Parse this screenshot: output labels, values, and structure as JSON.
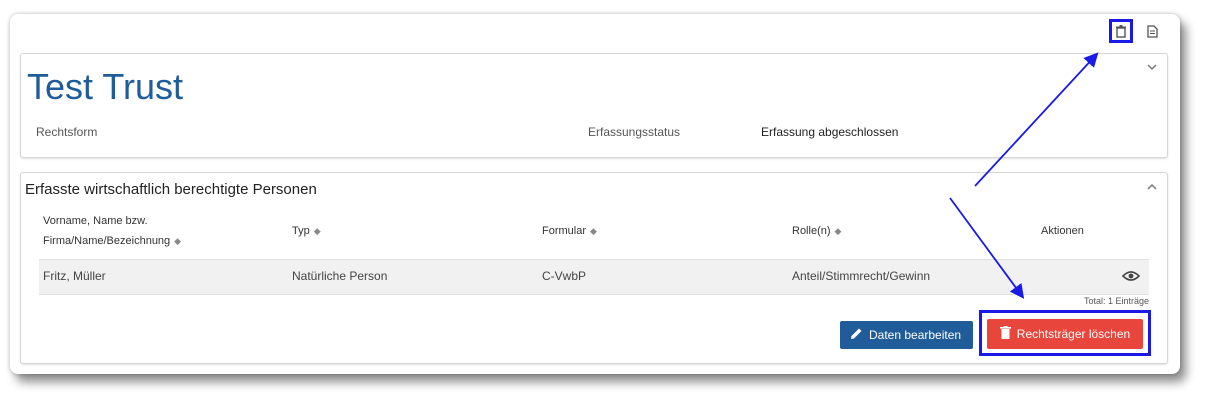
{
  "header": {
    "title": "Test Trust",
    "rechtsform_label": "Rechtsform",
    "status_label": "Erfassungsstatus",
    "status_value": "Erfassung abgeschlossen"
  },
  "toolbar": {
    "delete_icon": "trash-icon",
    "export_icon": "document-icon"
  },
  "section": {
    "title": "Erfasste wirtschaftlich berechtigte Personen",
    "columns": {
      "name_line1": "Vorname, Name bzw.",
      "name_line2": "Firma/Name/Bezeichnung",
      "typ": "Typ",
      "formular": "Formular",
      "rolle": "Rolle(n)",
      "aktionen": "Aktionen"
    },
    "rows": [
      {
        "name": "Fritz, Müller",
        "typ": "Natürliche Person",
        "formular": "C-VwbP",
        "rolle": "Anteil/Stimmrecht/Gewinn"
      }
    ],
    "total": "Total: 1 Einträge"
  },
  "actions": {
    "edit_label": "Daten bearbeiten",
    "delete_label": "Rechtsträger löschen"
  },
  "colors": {
    "title": "#1f5c99",
    "edit_button": "#1f5c99",
    "delete_button": "#e8453c",
    "annotation": "#1a1ae6"
  }
}
